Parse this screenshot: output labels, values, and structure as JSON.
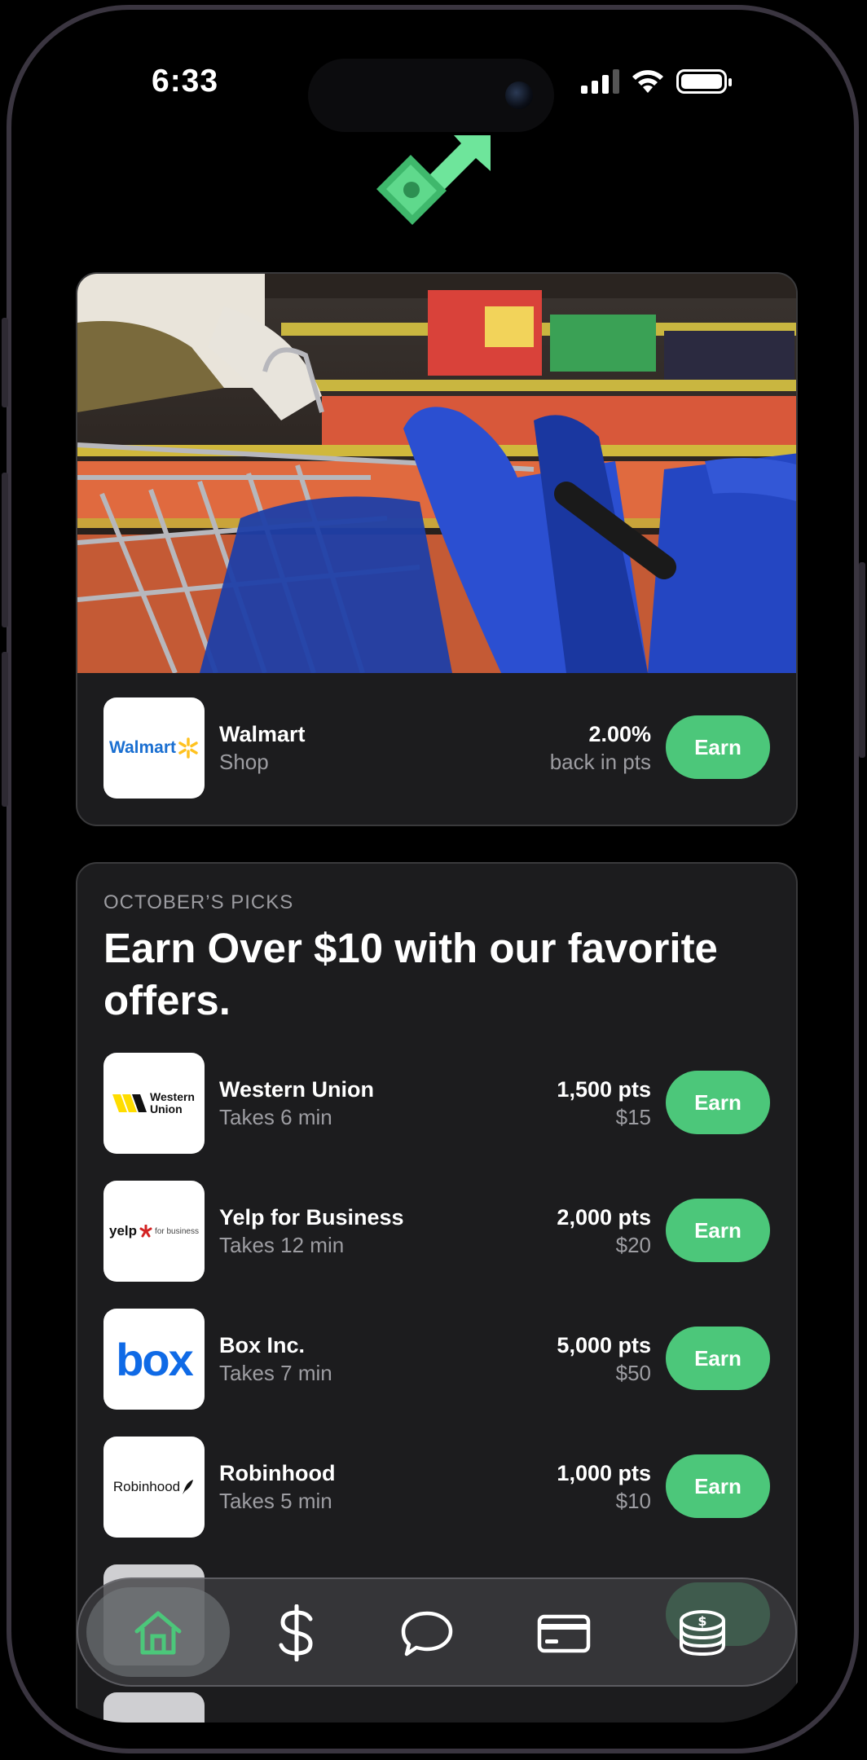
{
  "status_bar": {
    "time": "6:33",
    "icons": [
      "signal-icon",
      "wifi-icon",
      "battery-icon"
    ]
  },
  "app_logo": {
    "icon": "money-arrow-logo-icon",
    "color": "#4cc77a"
  },
  "featured": {
    "image": "grocery-cart-photo",
    "brand": "Walmart",
    "brand_logo_text": "Walmart",
    "subtitle": "Shop",
    "reward": "2.00%",
    "reward_sub": "back in pts",
    "button": "Earn"
  },
  "picks": {
    "eyebrow": "OCTOBER’S PICKS",
    "title": "Earn Over $10 with our favorite offers.",
    "offers": [
      {
        "name": "Western Union",
        "subtitle": "Takes 6 min",
        "points": "1,500 pts",
        "value": "$15",
        "button": "Earn",
        "logo_text": "Western Union"
      },
      {
        "name": "Yelp for Business",
        "subtitle": "Takes 12 min",
        "points": "2,000 pts",
        "value": "$20",
        "button": "Earn",
        "logo_text": "yelp",
        "logo_sub": "for business"
      },
      {
        "name": "Box Inc.",
        "subtitle": "Takes 7 min",
        "points": "5,000 pts",
        "value": "$50",
        "button": "Earn",
        "logo_text": "box"
      },
      {
        "name": "Robinhood",
        "subtitle": "Takes 5 min",
        "points": "1,000 pts",
        "value": "$10",
        "button": "Earn",
        "logo_text": "Robinhood"
      }
    ]
  },
  "tab_bar": {
    "items": [
      {
        "icon": "home-icon",
        "active": true
      },
      {
        "icon": "dollar-icon",
        "active": false
      },
      {
        "icon": "chat-bubble-icon",
        "active": false
      },
      {
        "icon": "credit-card-icon",
        "active": false
      },
      {
        "icon": "coins-icon",
        "active": false
      }
    ]
  },
  "colors": {
    "accent": "#4cc77a",
    "card": "#1c1c1e",
    "background": "#000000"
  }
}
